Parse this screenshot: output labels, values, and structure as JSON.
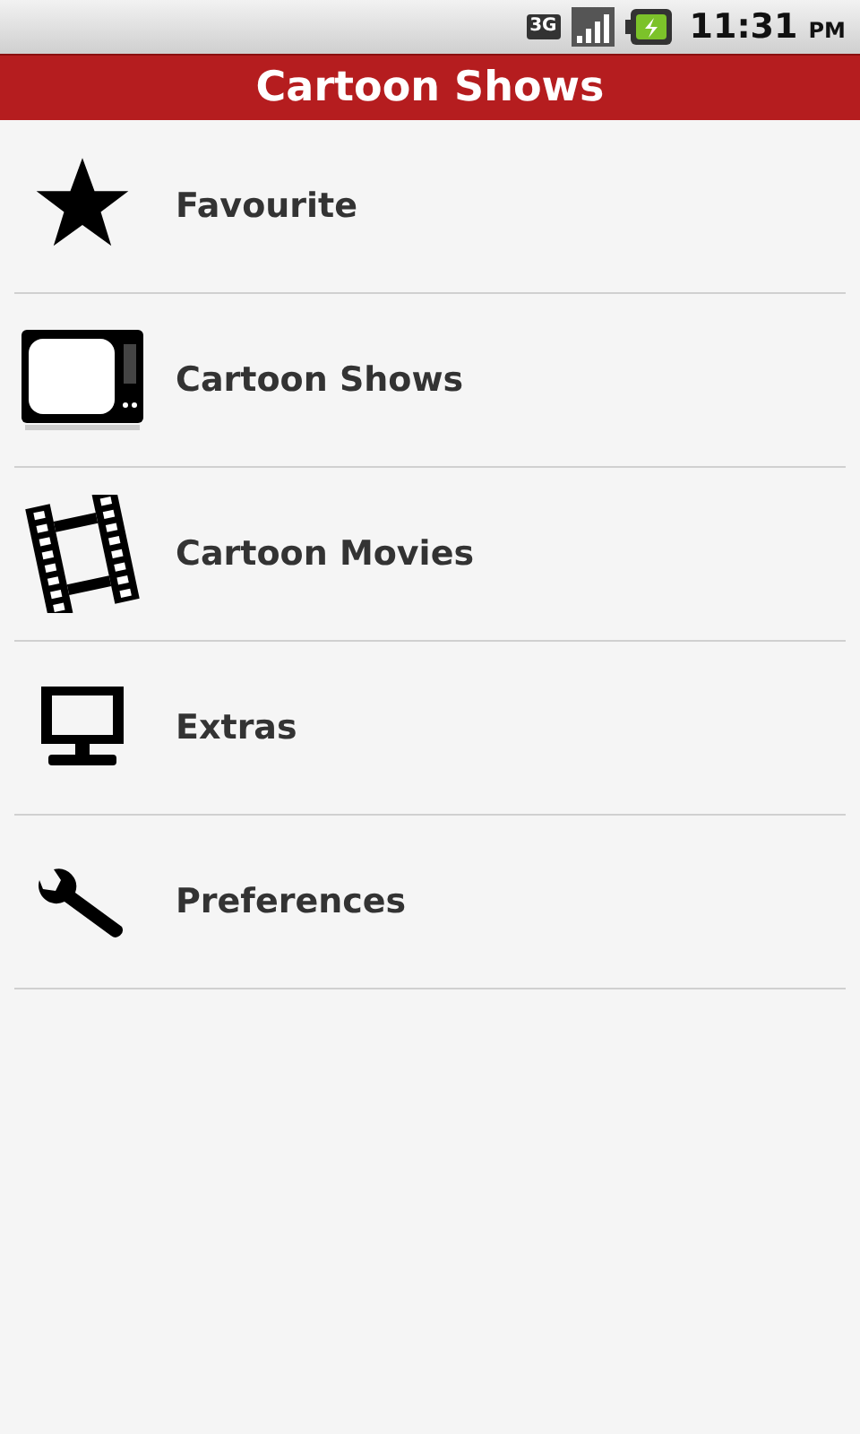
{
  "status_bar": {
    "network": "3G",
    "time": "11:31",
    "meridiem": "PM"
  },
  "title_bar": {
    "title": "Cartoon Shows"
  },
  "menu": [
    {
      "kind": "star",
      "label": "Favourite"
    },
    {
      "kind": "tv",
      "label": "Cartoon Shows"
    },
    {
      "kind": "film",
      "label": "Cartoon Movies"
    },
    {
      "kind": "monitor",
      "label": "Extras"
    },
    {
      "kind": "wrench",
      "label": "Preferences"
    }
  ]
}
